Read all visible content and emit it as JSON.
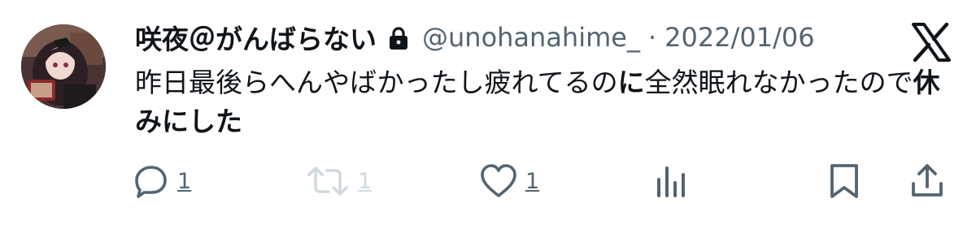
{
  "user": {
    "display_name": "咲夜＠がんばらない",
    "handle": "@unohanahime_",
    "separator": "·",
    "date": "2022/01/06",
    "avatar_icon": "avatar-anime-girl",
    "protected_icon": "lock-icon"
  },
  "post": {
    "segment_1": "昨日最後らへんやばかったし疲れてるの",
    "segment_2": "に",
    "segment_3": "全然眠れなかったので",
    "segment_4": "休みにした"
  },
  "actions": {
    "reply_count": "1",
    "repost_count": "1",
    "like_count": "1"
  },
  "colors": {
    "text": "#0f1419",
    "secondary": "#536471",
    "disabled": "#cfd9de"
  }
}
